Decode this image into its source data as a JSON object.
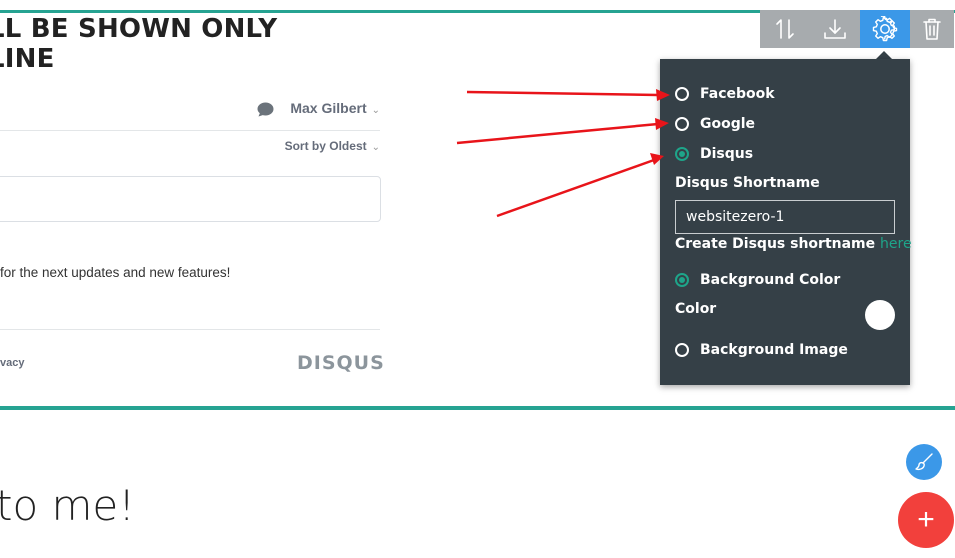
{
  "section": {
    "heading_line1": "LL BE SHOWN ONLY",
    "heading_line2": "LINE",
    "bottom_text": "to me!"
  },
  "disqus_widget": {
    "user_name": "Max Gilbert",
    "sort_label": "Sort by Oldest",
    "notice": "for the next updates and new features!",
    "privacy_link": "vacy",
    "logo_text": "DISQUS",
    "caret_glyph": "⌄"
  },
  "toolbar": {
    "buttons": [
      {
        "icon": "sort-icon"
      },
      {
        "icon": "download-icon"
      },
      {
        "icon": "gear-icon",
        "active": true
      },
      {
        "icon": "trash-icon"
      }
    ]
  },
  "settings_panel": {
    "providers": [
      {
        "label": "Facebook",
        "checked": false
      },
      {
        "label": "Google",
        "checked": false
      },
      {
        "label": "Disqus",
        "checked": true
      }
    ],
    "shortname_label": "Disqus Shortname",
    "shortname_value": "websitezero-1",
    "create_text": "Create Disqus shortname",
    "create_link": "here",
    "background_color_label": "Background Color",
    "color_label": "Color",
    "color_value": "#ffffff",
    "background_image_label": "Background Image"
  },
  "fab": {
    "add_glyph": "+"
  },
  "colors": {
    "accent_teal": "#26a392",
    "toolbar_gray": "#a7abae",
    "toolbar_active": "#3b98e8",
    "panel_bg": "#354047",
    "add_button": "#f2403c",
    "annotation_arrow": "#e8141a"
  }
}
